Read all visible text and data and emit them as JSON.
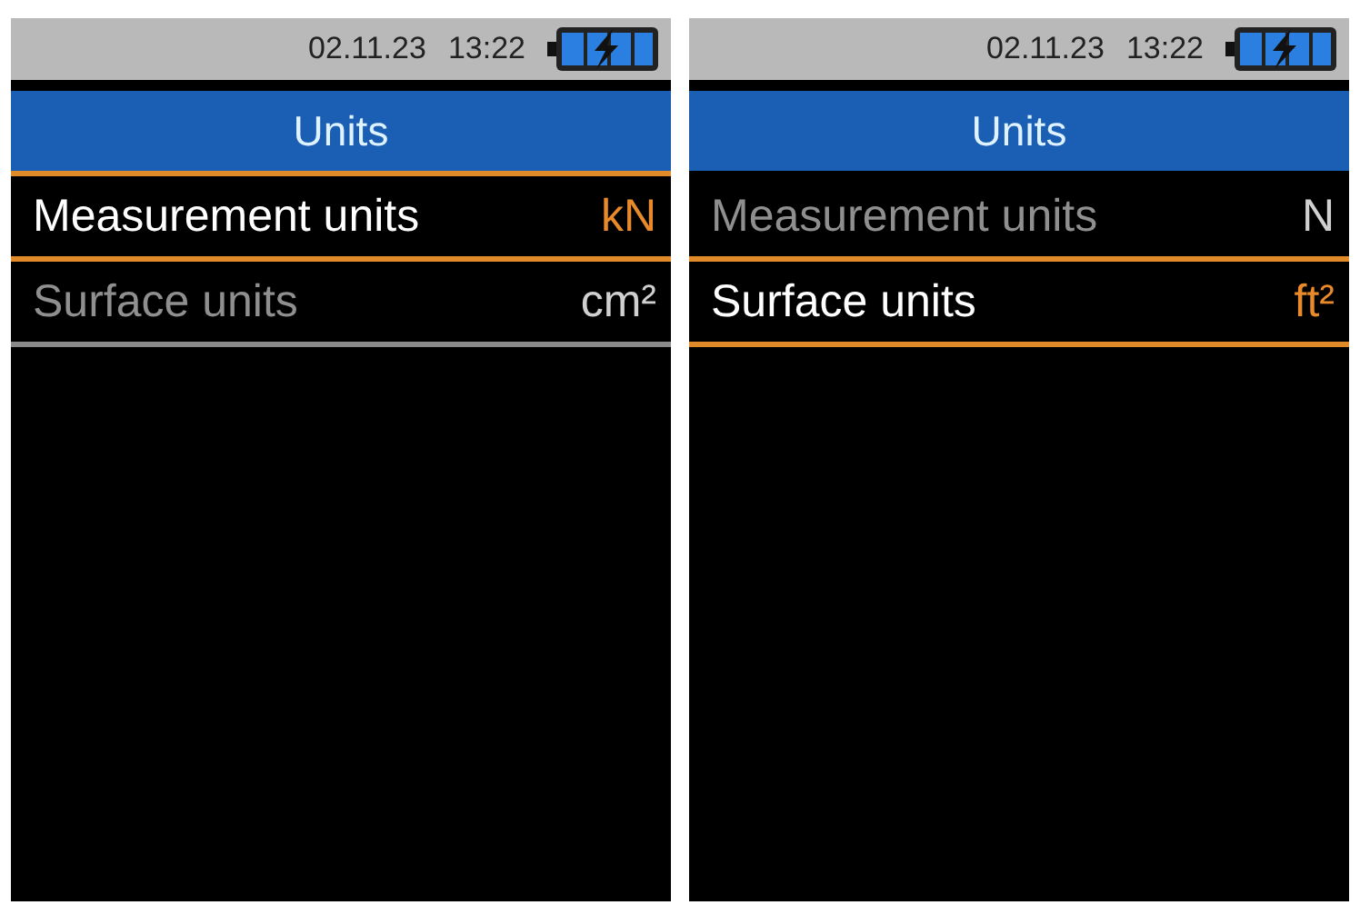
{
  "screens": [
    {
      "status_bar": {
        "date": "02.11.23",
        "time": "13:22"
      },
      "title": "Units",
      "rows": [
        {
          "label": "Measurement units",
          "value": "kN",
          "selected": true
        },
        {
          "label": "Surface units",
          "value": "cm²",
          "selected": false
        }
      ]
    },
    {
      "status_bar": {
        "date": "02.11.23",
        "time": "13:22"
      },
      "title": "Units",
      "rows": [
        {
          "label": "Measurement units",
          "value": "N",
          "selected": false
        },
        {
          "label": "Surface units",
          "value": "ft²",
          "selected": true
        }
      ]
    }
  ]
}
